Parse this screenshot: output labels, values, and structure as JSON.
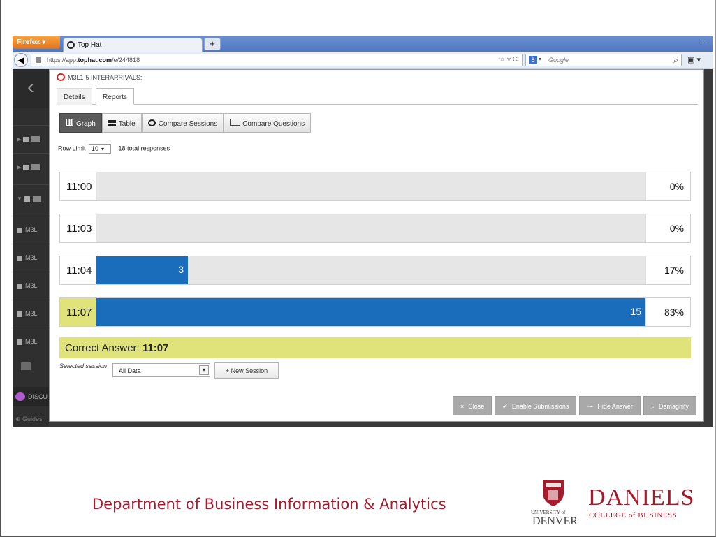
{
  "browser": {
    "app_menu": "Firefox",
    "tab_title": "Top Hat",
    "new_tab": "+",
    "url_prefix": "https://app.",
    "url_domain": "tophat.com",
    "url_path": "/e/244818",
    "search_engine": "8",
    "search_placeholder": "Google"
  },
  "sidebar": {
    "partial_items": [
      "M3L",
      "M3L",
      "M3L",
      "M3L",
      "M3L"
    ],
    "discussion_label": "DISCU",
    "guides_label": "Guides"
  },
  "modal": {
    "title": "M3L1-5 INTERARRIVALS:",
    "tabs": [
      "Details",
      "Reports"
    ],
    "active_tab": "Reports",
    "view_buttons": [
      "Graph",
      "Table",
      "Compare Sessions",
      "Compare Questions"
    ],
    "active_view": "Graph",
    "row_limit_label": "Row Limit",
    "row_limit_value": "10",
    "total_responses": "18 total responses",
    "answers": [
      {
        "label": "11:00",
        "count": "",
        "percent": "0%",
        "fraction": 0.0,
        "correct": false
      },
      {
        "label": "11:03",
        "count": "",
        "percent": "0%",
        "fraction": 0.0,
        "correct": false
      },
      {
        "label": "11:04",
        "count": "3",
        "percent": "17%",
        "fraction": 0.1667,
        "correct": false
      },
      {
        "label": "11:07",
        "count": "15",
        "percent": "83%",
        "fraction": 1.0,
        "correct": true
      }
    ],
    "correct_answer_label": "Correct Answer:",
    "correct_answer_value": "11:07",
    "selected_session_label": "Selected session",
    "selected_session_value": "All Data",
    "new_session_button": "+ New Session",
    "footer_buttons": [
      {
        "icon": "×",
        "label": "Close"
      },
      {
        "icon": "✔",
        "label": "Enable Submissions"
      },
      {
        "icon": "⁓",
        "label": "Hide Answer"
      },
      {
        "icon": "⌕",
        "label": "Demagnify"
      }
    ]
  },
  "slide": {
    "department": "Department of Business Information & Analytics",
    "logo_university": "UNIVERSITY of",
    "logo_denver": "DENVER",
    "logo_daniels": "DANIELS",
    "logo_college": "COLLEGE of BUSINESS"
  },
  "colors": {
    "bar_fill": "#1a6dbb",
    "correct_highlight": "#dfe37a",
    "brand_red": "#a61b2c"
  }
}
